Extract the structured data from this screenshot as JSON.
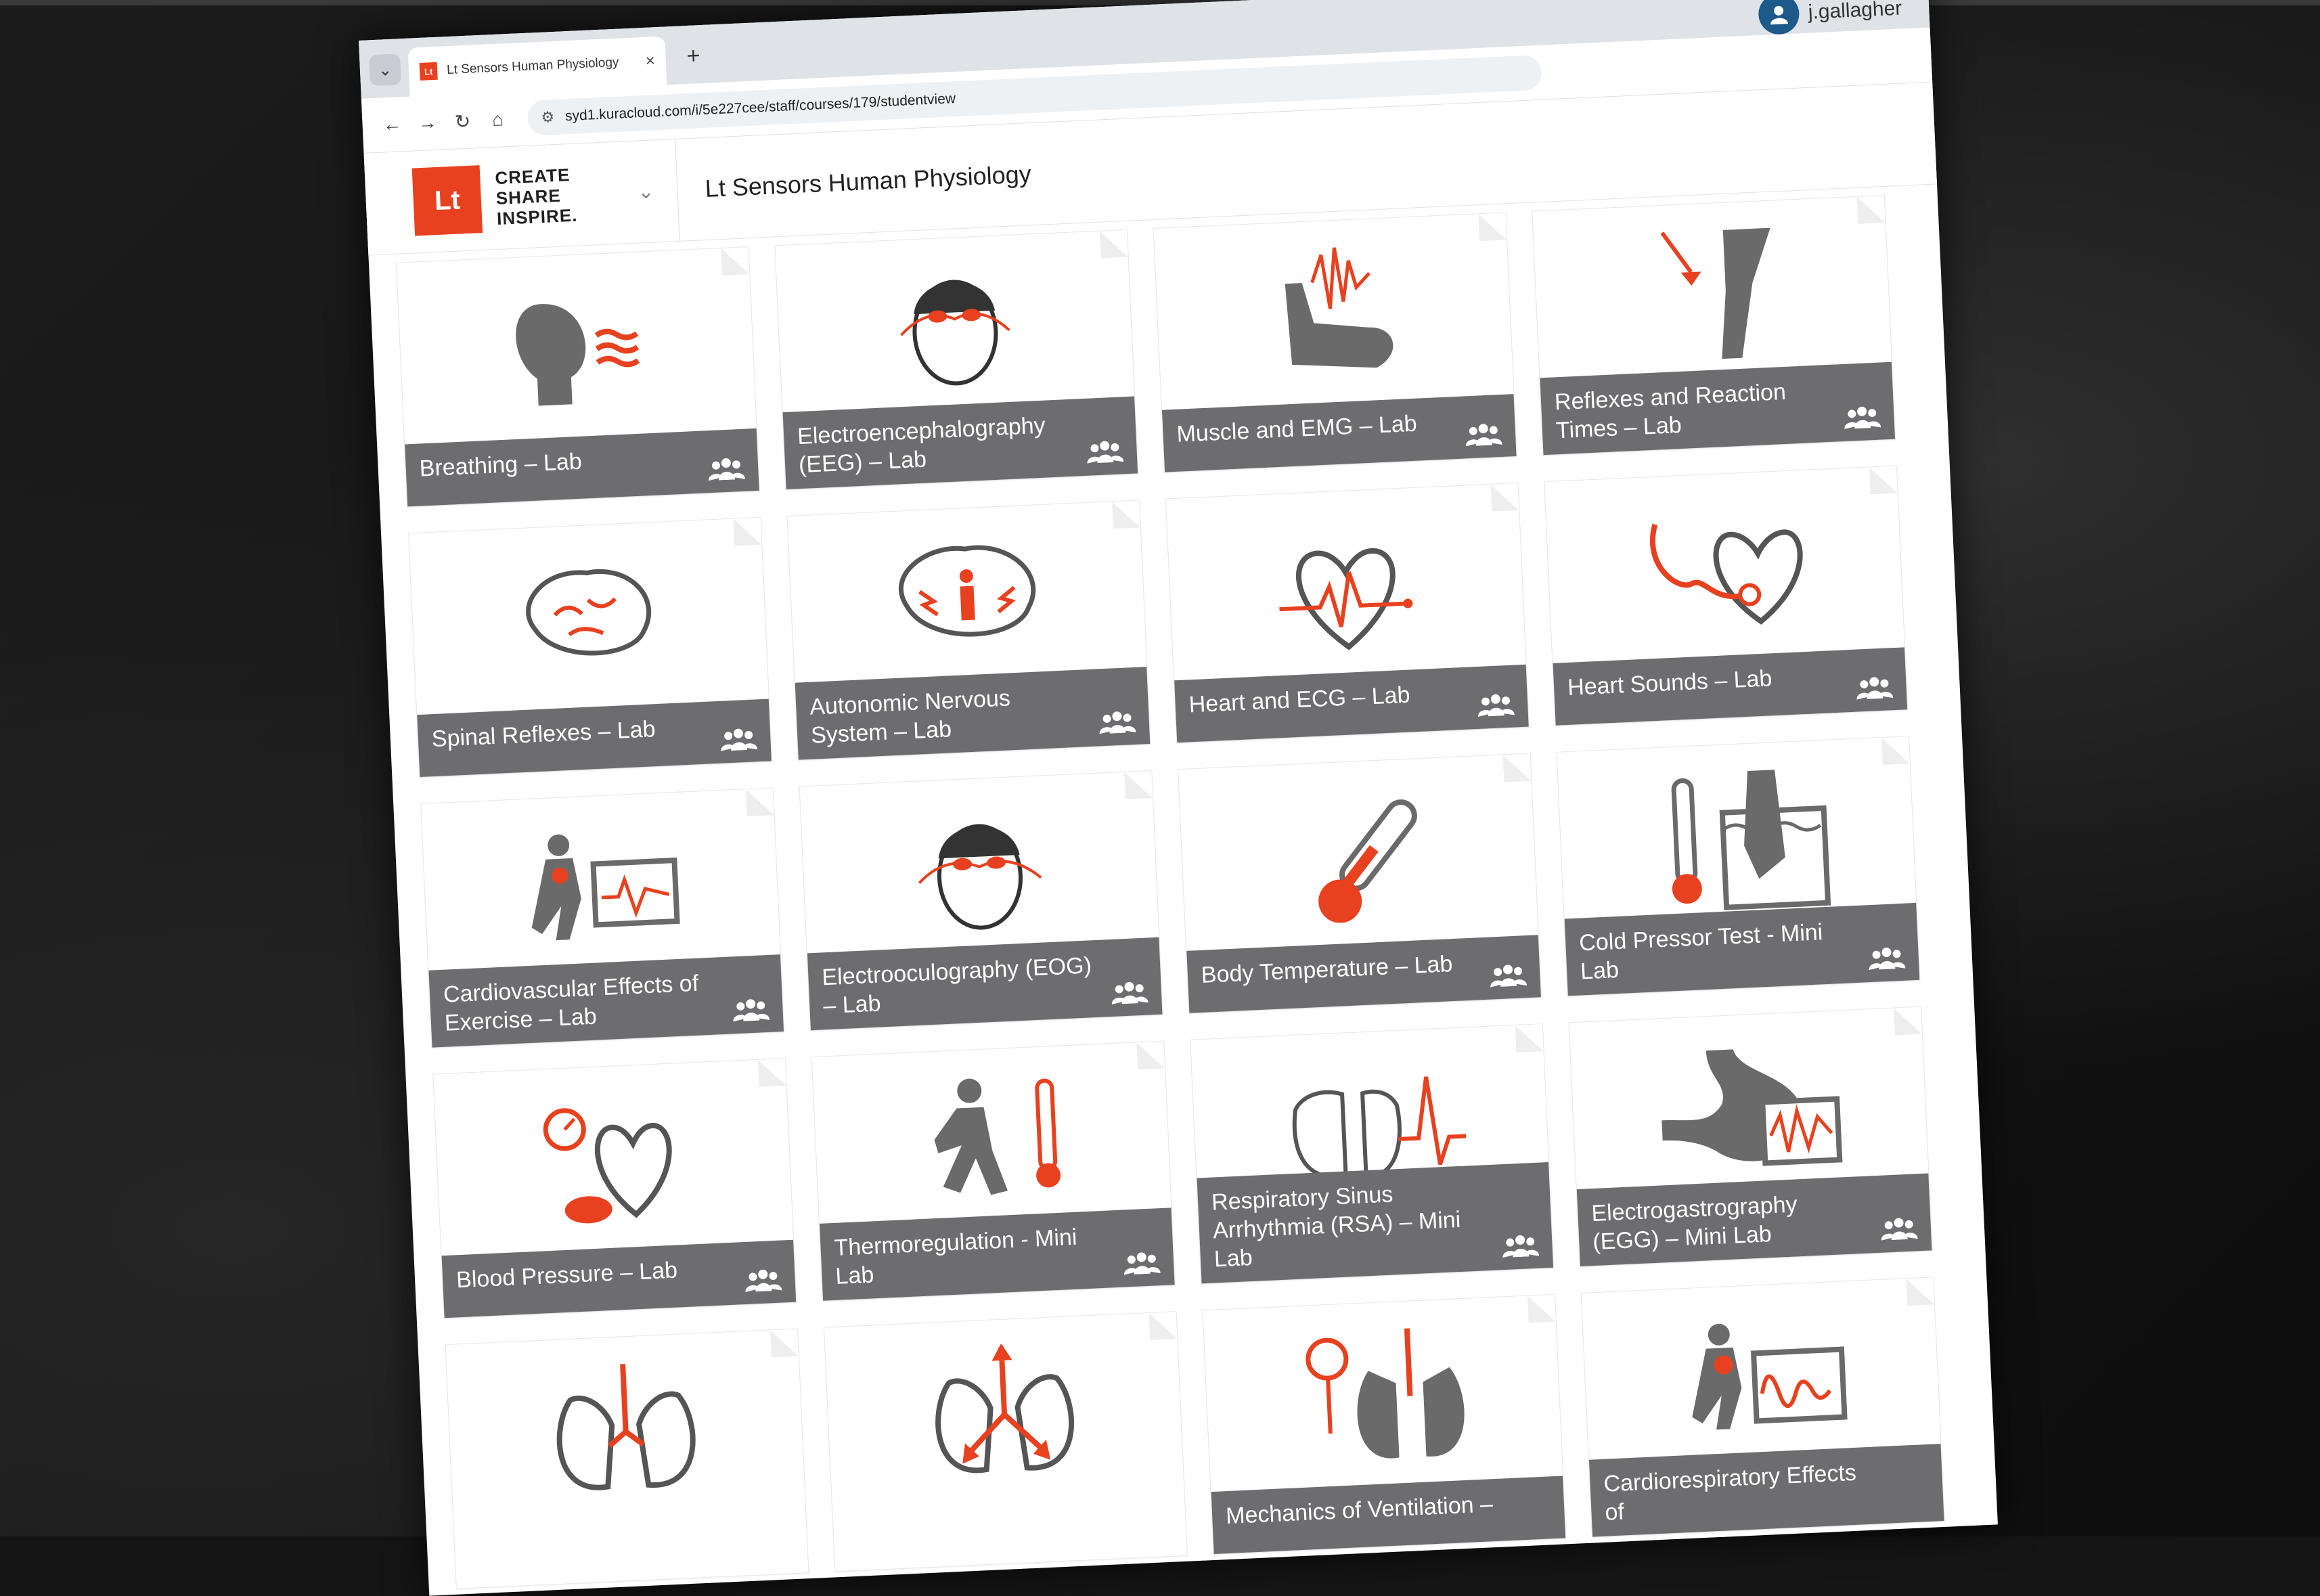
{
  "browser": {
    "tab": {
      "title": "Lt Sensors Human Physiology",
      "favicon": "Lt"
    },
    "url": "syd1.kuracloud.com/i/5e227cee/staff/courses/179/studentview"
  },
  "user": {
    "name": "j.gallagher",
    "icon": "user-avatar-icon"
  },
  "app": {
    "logo": "Lt",
    "tagline": [
      "CREATE",
      "SHARE",
      "INSPIRE."
    ],
    "course_title": "Lt Sensors Human Physiology"
  },
  "colors": {
    "accent": "#e8411f",
    "footer": "#6d6d6f",
    "icon_gray": "#6a6a6a"
  },
  "cards": [
    {
      "title": "Breathing – Lab",
      "icon": "breathing-icon"
    },
    {
      "title": "Electroencephalography (EEG) – Lab",
      "icon": "eeg-head-icon"
    },
    {
      "title": "Muscle and EMG – Lab",
      "icon": "muscle-emg-icon"
    },
    {
      "title": "Reflexes and Reaction Times – Lab",
      "icon": "knee-reflex-icon"
    },
    {
      "title": "Spinal Reflexes – Lab",
      "icon": "brain-icon"
    },
    {
      "title": "Autonomic Nervous System – Lab",
      "icon": "brain-person-icon"
    },
    {
      "title": "Heart and ECG – Lab",
      "icon": "heart-ecg-icon"
    },
    {
      "title": "Heart Sounds – Lab",
      "icon": "stethoscope-heart-icon"
    },
    {
      "title": "Cardiovascular Effects of Exercise – Lab",
      "icon": "runner-monitor-icon"
    },
    {
      "title": "Electrooculography (EOG) – Lab",
      "icon": "eog-head-icon"
    },
    {
      "title": "Body Temperature – Lab",
      "icon": "thermometer-icon"
    },
    {
      "title": "Cold Pressor Test - Mini Lab",
      "icon": "hand-in-water-icon"
    },
    {
      "title": "Blood Pressure – Lab",
      "icon": "blood-pressure-icon"
    },
    {
      "title": "Thermoregulation - Mini Lab",
      "icon": "runner-thermometer-icon"
    },
    {
      "title": "Respiratory Sinus Arrhythmia (RSA) – Mini Lab",
      "icon": "lungs-ecg-icon"
    },
    {
      "title": "Electrogastrography (EGG) – Mini Lab",
      "icon": "stomach-monitor-icon"
    },
    {
      "title": "",
      "icon": "lungs-icon"
    },
    {
      "title": "",
      "icon": "lungs-arrows-icon"
    },
    {
      "title": "Mechanics of Ventilation –",
      "icon": "lungs-gauge-icon"
    },
    {
      "title": "Cardiorespiratory Effects of",
      "icon": "runner-lungs-monitor-icon"
    }
  ]
}
